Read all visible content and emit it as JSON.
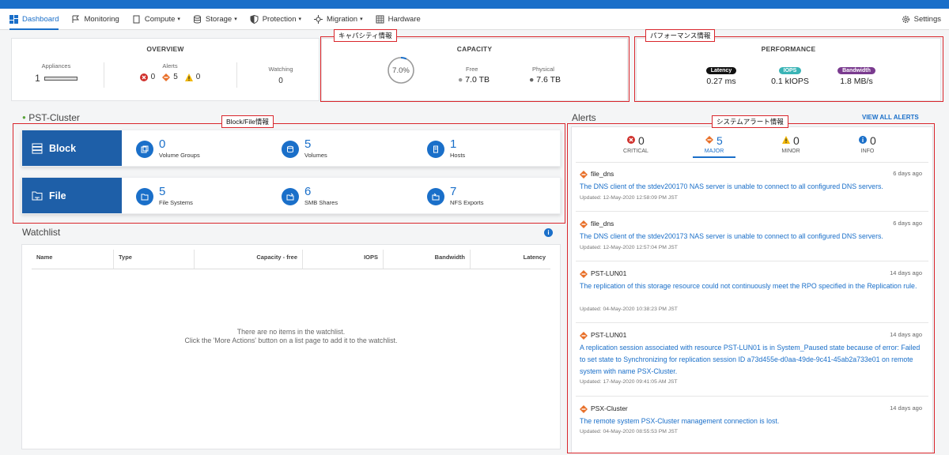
{
  "nav": {
    "items": [
      {
        "label": "Dashboard",
        "icon": "dashboard-icon",
        "caret": false
      },
      {
        "label": "Monitoring",
        "icon": "flag-icon",
        "caret": false
      },
      {
        "label": "Compute",
        "icon": "compute-icon",
        "caret": true
      },
      {
        "label": "Storage",
        "icon": "database-icon",
        "caret": true
      },
      {
        "label": "Protection",
        "icon": "shield-icon",
        "caret": true
      },
      {
        "label": "Migration",
        "icon": "migration-icon",
        "caret": true
      },
      {
        "label": "Hardware",
        "icon": "hardware-icon",
        "caret": false
      }
    ],
    "settings": "Settings",
    "caret_glyph": "▾"
  },
  "overview": {
    "title": "OVERVIEW",
    "appliances_label": "Appliances",
    "appliances_value": "1",
    "alerts_label": "Alerts",
    "alert_critical": "0",
    "alert_major": "5",
    "alert_minor": "0",
    "watching_label": "Watching",
    "watching_value": "0"
  },
  "capacity": {
    "title": "CAPACITY",
    "percent": "7.0%",
    "percent_value": 7.0,
    "free_label": "Free",
    "free_value": "7.0 TB",
    "physical_label": "Physical",
    "physical_value": "7.6 TB",
    "tag": "キャパシティ情報"
  },
  "performance": {
    "title": "PERFORMANCE",
    "latency_label": "Latency",
    "latency_value": "0.27 ms",
    "iops_label": "IOPS",
    "iops_value": "0.1 kIOPS",
    "bandwidth_label": "Bandwidth",
    "bandwidth_value": "1.8 MB/s",
    "tag": "パフォーマンス情報",
    "colors": {
      "latency": "#111111",
      "iops": "#3ab4b6",
      "bandwidth": "#7a3b8f"
    }
  },
  "cluster": {
    "name": "PST-Cluster",
    "tag": "Block/File情報",
    "block": {
      "label": "Block",
      "stats": [
        {
          "value": "0",
          "label": "Volume Groups"
        },
        {
          "value": "5",
          "label": "Volumes"
        },
        {
          "value": "1",
          "label": "Hosts"
        }
      ]
    },
    "file": {
      "label": "File",
      "stats": [
        {
          "value": "5",
          "label": "File Systems"
        },
        {
          "value": "6",
          "label": "SMB Shares"
        },
        {
          "value": "7",
          "label": "NFS Exports"
        }
      ]
    }
  },
  "watchlist": {
    "title": "Watchlist",
    "columns": [
      "Name",
      "Type",
      "Capacity - free",
      "IOPS",
      "Bandwidth",
      "Latency"
    ],
    "empty_line1": "There are no items in the watchlist.",
    "empty_line2": "Click the 'More Actions' button on a list page to add it to the watchlist."
  },
  "alerts": {
    "title": "Alerts",
    "view_all": "VIEW ALL ALERTS",
    "tag": "システムアラート情報",
    "tabs": [
      {
        "count": "0",
        "label": "CRITICAL"
      },
      {
        "count": "5",
        "label": "MAJOR"
      },
      {
        "count": "0",
        "label": "MINOR"
      },
      {
        "count": "0",
        "label": "INFO"
      }
    ],
    "items": [
      {
        "name": "file_dns",
        "time": "6 days ago",
        "message": "The DNS client of the stdev200170 NAS server is unable to connect to all configured DNS servers.",
        "updated": "Updated: 12-May-2020 12:58:09 PM JST"
      },
      {
        "name": "file_dns",
        "time": "6 days ago",
        "message": "The DNS client of the stdev200173 NAS server is unable to connect to all configured DNS servers.",
        "updated": "Updated: 12-May-2020 12:57:04 PM JST"
      },
      {
        "name": "PST-LUN01",
        "time": "14 days ago",
        "message": "The replication of this storage resource could not continuously meet the RPO specified in the Replication rule.",
        "updated": "Updated: 04-May-2020 10:38:23 PM JST"
      },
      {
        "name": "PST-LUN01",
        "time": "14 days ago",
        "message": "A replication session associated with resource PST-LUN01 is in System_Paused state because of error: Failed to set state to Synchronizing for replication session ID a73d455e-d0aa-49de-9c41-45ab2a733e01 on remote system with name PSX-Cluster.",
        "updated": "Updated: 17-May-2020 09:41:05 AM JST"
      },
      {
        "name": "PSX-Cluster",
        "time": "14 days ago",
        "message": "The remote system PSX-Cluster management connection is lost.",
        "updated": "Updated: 04-May-2020 08:55:53 PM JST"
      }
    ]
  },
  "colors": {
    "accent": "#1a6fc9",
    "tile": "#1e5fa8",
    "critical": "#d0312d",
    "major": "#e8702a",
    "minor": "#f2b705",
    "info": "#1a6fc9",
    "annotation": "#d9262c"
  }
}
